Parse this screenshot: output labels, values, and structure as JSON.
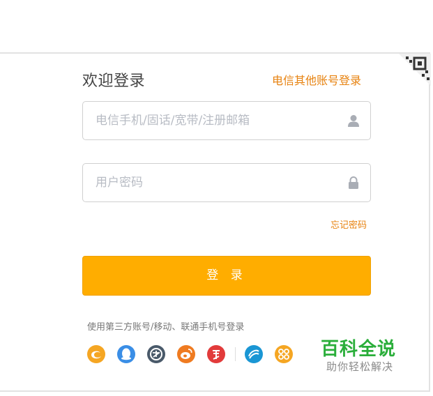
{
  "header": {
    "title": "欢迎登录",
    "other_account_link": "电信其他账号登录"
  },
  "form": {
    "account_placeholder": "电信手机/固话/宽带/注册邮箱",
    "password_placeholder": "用户密码",
    "forgot_password": "忘记密码",
    "submit_label": "登 录"
  },
  "third_party": {
    "label": "使用第三方账号/移动、联通手机号登录",
    "providers": [
      {
        "icon": "tianyi-icon",
        "color": "#f5a623"
      },
      {
        "icon": "qq-icon",
        "color": "#3a8ee6"
      },
      {
        "icon": "alipay-icon",
        "color": "#4a5a6a"
      },
      {
        "icon": "weibo-icon",
        "color": "#ef7b21"
      },
      {
        "icon": "taobao-icon",
        "color": "#e23b3b"
      },
      {
        "icon": "china-mobile-icon",
        "color": "#1a96d4"
      },
      {
        "icon": "china-unicom-icon",
        "color": "#f5a623"
      }
    ]
  },
  "watermark": {
    "title": "百科全说",
    "subtitle": "助你轻松解决"
  },
  "colors": {
    "accent": "#e7820f",
    "button": "#ffad00",
    "watermark": "#2aae3a"
  }
}
